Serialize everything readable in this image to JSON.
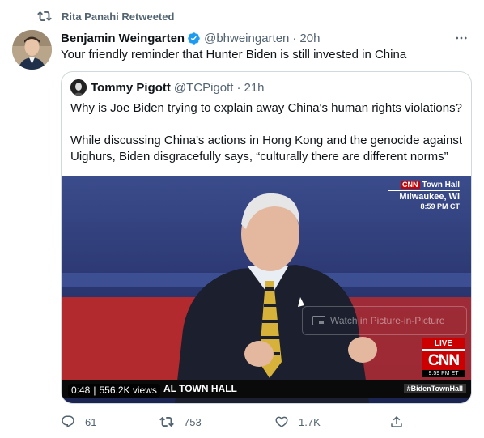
{
  "retweet": {
    "label": "Rita Panahi Retweeted"
  },
  "tweet": {
    "author_name": "Benjamin Weingarten",
    "handle": "@bhweingarten",
    "time": "20h",
    "text": "Your friendly reminder that Hunter Biden is still invested in China"
  },
  "quote": {
    "author_name": "Tommy Pigott",
    "handle": "@TCPigott",
    "time": "21h",
    "paragraph1": "Why is Joe Biden trying to explain away China's human rights violations?",
    "paragraph2": "While discussing China's actions in Hong Kong and the genocide against Uighurs, Biden disgracefully says, “culturally there are different norms”"
  },
  "video": {
    "network_mini": "CNN",
    "location_line1": "Town Hall",
    "location_line2": "Milwaukee, WI",
    "location_time": "8:59 PM CT",
    "pip_label": "Watch in Picture-in-Picture",
    "live_label": "LIVE",
    "network_logo": "CNN",
    "live_time": "9:59 PM ET",
    "lower_third_title": "AL TOWN HALL",
    "lower_third_tag": "#BidenTownHall",
    "duration": "0:48",
    "views": "556.2K views"
  },
  "actions": {
    "reply_count": "61",
    "retweet_count": "753",
    "like_count": "1.7K"
  },
  "icons": [
    "retweet-icon",
    "verified-icon",
    "more-icon",
    "reply-icon",
    "like-icon",
    "share-icon",
    "pip-icon"
  ],
  "colors": {
    "secondary_text": "#536471",
    "verified_blue": "#1d9bf0",
    "border": "#cfd9de",
    "cnn_red": "#cc0000"
  }
}
